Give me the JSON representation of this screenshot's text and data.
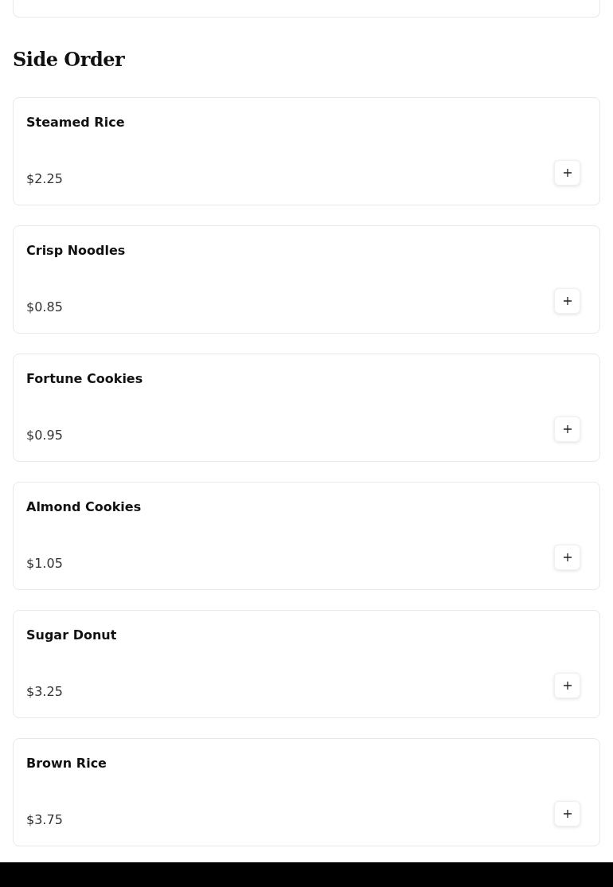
{
  "section": {
    "title": "Side Order"
  },
  "items": [
    {
      "name": "Steamed Rice",
      "price": "$2.25"
    },
    {
      "name": "Crisp Noodles",
      "price": "$0.85"
    },
    {
      "name": "Fortune Cookies",
      "price": "$0.95"
    },
    {
      "name": "Almond Cookies",
      "price": "$1.05"
    },
    {
      "name": "Sugar Donut",
      "price": "$3.25"
    },
    {
      "name": "Brown Rice",
      "price": "$3.75"
    }
  ]
}
